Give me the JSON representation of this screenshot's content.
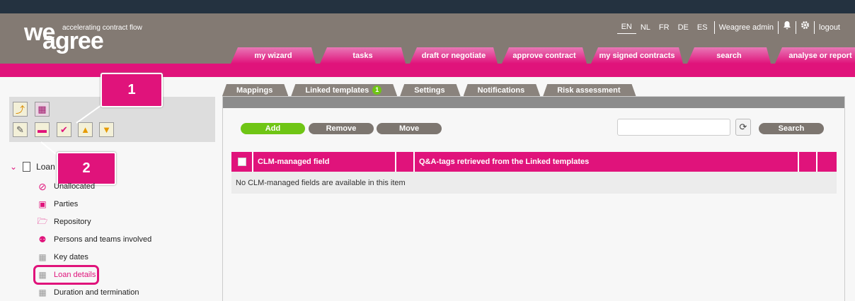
{
  "brand": {
    "logo_we": "we",
    "logo_agree": "agree",
    "tagline": "accelerating contract flow"
  },
  "topbar": {
    "languages": [
      "EN",
      "NL",
      "FR",
      "DE",
      "ES"
    ],
    "active_language": "EN",
    "user": "Weagree admin",
    "logout": "logout",
    "bell_icon": "bell-icon",
    "settings_icon": "gear-icon"
  },
  "nav": {
    "tabs": [
      {
        "label": "my wizard"
      },
      {
        "label": "tasks"
      },
      {
        "label": "draft or negotiate"
      },
      {
        "label": "approve contract"
      },
      {
        "label": "my signed contracts"
      },
      {
        "label": "search"
      },
      {
        "label": "analyse or report"
      }
    ]
  },
  "callouts": {
    "one": "1",
    "two": "2"
  },
  "tree": {
    "root_label": "Loan",
    "items": [
      {
        "label": "Unallocated",
        "icon": "no-entry-icon"
      },
      {
        "label": "Parties",
        "icon": "contact-card-icon"
      },
      {
        "label": "Repository",
        "icon": "folder-icon"
      },
      {
        "label": "Persons and teams involved",
        "icon": "people-icon"
      },
      {
        "label": "Key dates",
        "icon": "bricks-icon"
      },
      {
        "label": "Loan details",
        "icon": "bricks-icon"
      },
      {
        "label": "Duration and termination",
        "icon": "bricks-icon"
      }
    ],
    "selected": "Loan details"
  },
  "content": {
    "tabs": [
      {
        "label": "Mappings"
      },
      {
        "label": "Linked templates",
        "badge": "1"
      },
      {
        "label": "Settings"
      },
      {
        "label": "Notifications"
      },
      {
        "label": "Risk assessment"
      }
    ],
    "buttons": {
      "add": "Add",
      "remove": "Remove",
      "move": "Move",
      "search": "Search"
    },
    "search": {
      "value": "",
      "placeholder": ""
    },
    "grid": {
      "columns": [
        "CLM-managed field",
        "Q&A-tags retrieved from the Linked templates"
      ],
      "empty_message": "No CLM-managed fields are available in this item"
    }
  },
  "colors": {
    "accent": "#e0137b",
    "header": "#837a73",
    "add_button": "#6fc515",
    "button": "#7d7670"
  }
}
